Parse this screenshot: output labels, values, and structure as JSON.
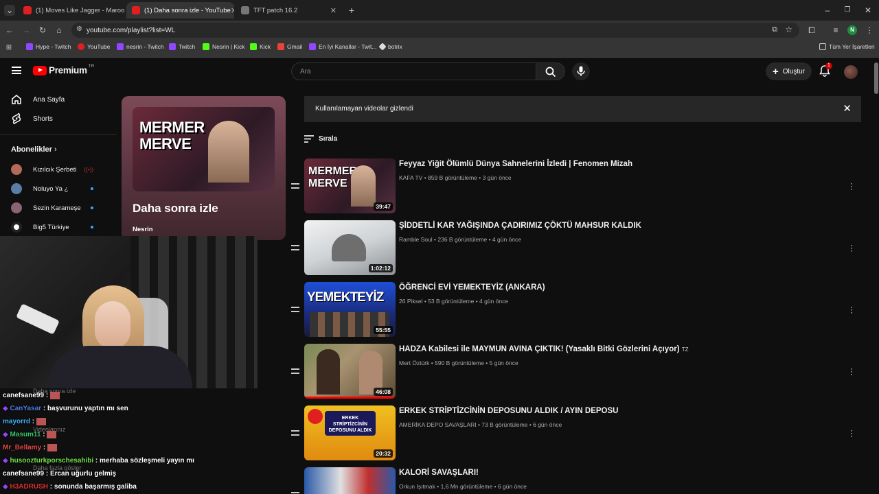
{
  "browser": {
    "tabs": [
      {
        "title": "(1) Moves Like Jagger - Maroon",
        "active": false
      },
      {
        "title": "(1) Daha sonra izle - YouTube",
        "active": true
      },
      {
        "title": "TFT patch 16.2",
        "active": false
      }
    ],
    "url": "youtube.com/playlist?list=WL",
    "profile_initial": "N",
    "bookmarks": [
      "Hype - Twitch",
      "YouTube",
      "nesrin - Twitch",
      "Twitch",
      "Nesrin | Kick",
      "Kick",
      "Gmail",
      "En İyi Kanallar - Twit...",
      "botrix"
    ],
    "all_bookmarks": "Tüm Yer İşaretleri"
  },
  "yt": {
    "logo": "Premium",
    "region": "TR",
    "search_placeholder": "Ara",
    "create_label": "Oluştur",
    "notif_count": "1"
  },
  "sidebar": {
    "home": "Ana Sayfa",
    "shorts": "Shorts",
    "subs_heading": "Abonelikler",
    "subs": [
      "Kızılcık Şerbeti",
      "Noluyo Ya ¿",
      "Sezin Karameşe",
      "Big5 Türkiye"
    ],
    "hidden": [
      "Daha sonra izle",
      "Videolarınız",
      "Daha fazla göster"
    ]
  },
  "playlist": {
    "title": "Daha sonra izle",
    "owner": "Nesrin",
    "banner": "Kullanılamayan videolar gizlendi",
    "sort": "Sırala"
  },
  "videos": [
    {
      "title": "Feyyaz Yiğit Ölümlü Dünya Sahnelerini İzledi | Fenomen Mizah",
      "channel": "KAFA TV",
      "views": "859 B görüntüleme",
      "ago": "3 gün önce",
      "duration": "39:47",
      "thumb_text": "MERMER MERVE"
    },
    {
      "title": "ŞİDDETLİ KAR YAĞIŞINDA ÇADIRIMIZ ÇÖKTÜ MAHSUR KALDIK",
      "channel": "Ramble Soul",
      "views": "236 B görüntüleme",
      "ago": "4 gün önce",
      "duration": "1:02:12",
      "thumb_text": ""
    },
    {
      "title": "ÖĞRENCİ EVİ YEMEKTEYİZ (ANKARA)",
      "channel": "26 Piksel",
      "views": "53 B görüntüleme",
      "ago": "4 gün önce",
      "duration": "55:55",
      "thumb_text": "YEMEKTEYİZ"
    },
    {
      "title": "HADZA Kabilesi ile MAYMUN AVINA ÇIKTIK! (Yasaklı Bitki Gözlerini Açıyor)",
      "suffix": "TZ",
      "channel": "Mert Öztürk",
      "views": "590 B görüntüleme",
      "ago": "5 gün önce",
      "duration": "46:08",
      "thumb_text": ""
    },
    {
      "title": "ERKEK STRİPTİZCİNİN DEPOSUNU ALDIK / AYIN DEPOSU",
      "channel": "AMERİKA DEPO SAVAŞLARI",
      "views": "73 B görüntüleme",
      "ago": "6 gün önce",
      "duration": "20:32",
      "thumb_text": "ERKEK STRİPTİZCİNİN DEPOSUNU ALDIK"
    },
    {
      "title": "KALORİ SAVAŞLARI!",
      "channel": "Orkun Işıtmak",
      "views": "1,6 Mn görüntüleme",
      "ago": "6 gün önce",
      "duration": "",
      "thumb_text": ""
    }
  ],
  "chat": [
    {
      "user": "canefsane99",
      "color": "#ffffff",
      "msg": ""
    },
    {
      "user": "CanYasar",
      "color": "#4b7bd8",
      "msg": "başvurunu yaptın mı sen"
    },
    {
      "user": "mayorrd",
      "color": "#3fb0ff",
      "msg": ""
    },
    {
      "user": "Masum11",
      "color": "#39c26a",
      "msg": ""
    },
    {
      "user": "Mr_Bellamy",
      "color": "#e04848",
      "msg": ""
    },
    {
      "user": "husoozturkporschesahibi",
      "color": "#6fe04e",
      "msg": "merhaba sözleşmeli yayın mı"
    },
    {
      "user": "canefsane99",
      "color": "#ffffff",
      "msg": "Ercan uğurlu gelmiş"
    },
    {
      "user": "H3ADRUSH",
      "color": "#e03030",
      "msg": "sonunda başarmış galiba"
    }
  ]
}
